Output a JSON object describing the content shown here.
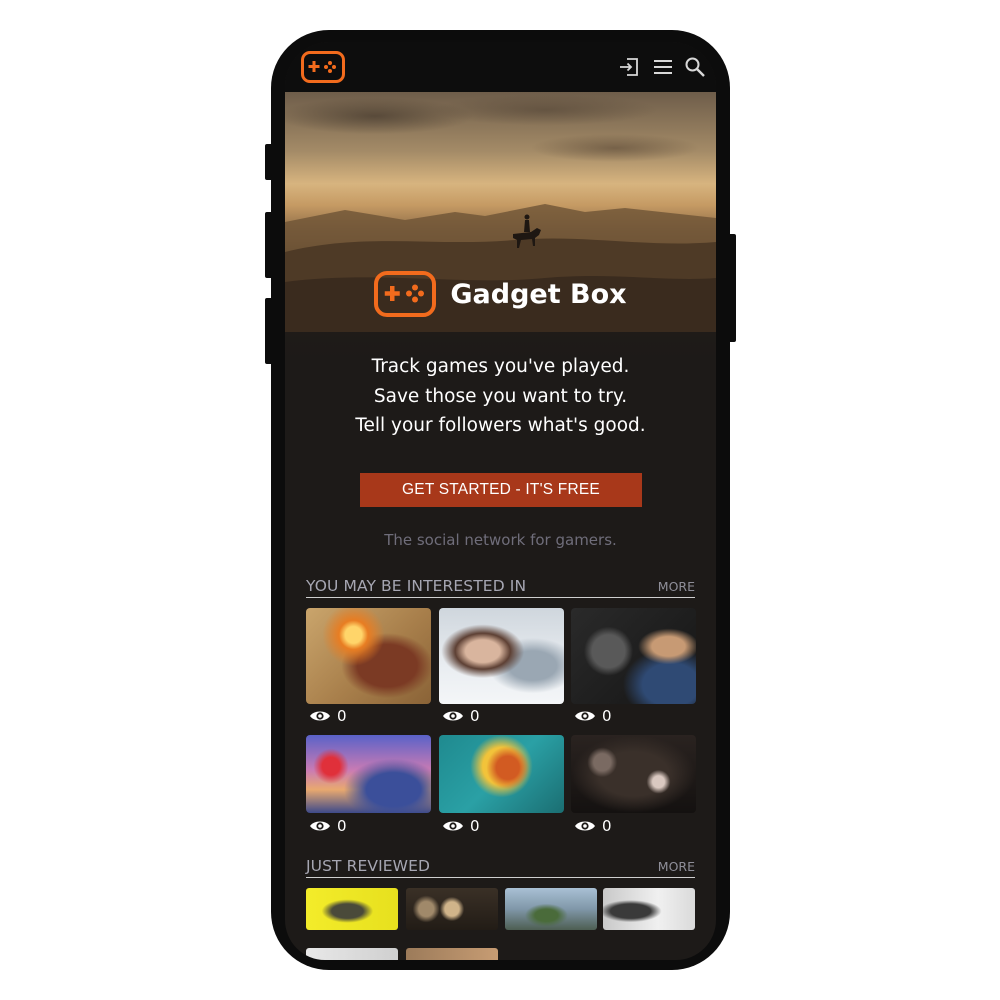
{
  "header": {
    "logo_icon": "gamepad-icon",
    "actions": [
      {
        "icon": "login-icon"
      },
      {
        "icon": "menu-icon"
      },
      {
        "icon": "search-icon"
      }
    ]
  },
  "hero": {
    "brand_name": "Gadget Box",
    "tagline": [
      "Track games you've played.",
      "Save those you want to try.",
      "Tell your followers what's good."
    ],
    "cta_label": "GET STARTED - IT'S FREE",
    "subtagline": "The social network for gamers."
  },
  "sections": {
    "interested": {
      "title": "YOU MAY BE INTERESTED IN",
      "more_label": "MORE",
      "items": [
        {
          "views": "0"
        },
        {
          "views": "0"
        },
        {
          "views": "0"
        },
        {
          "views": "0"
        },
        {
          "views": "0"
        },
        {
          "views": "0"
        }
      ]
    },
    "reviewed": {
      "title": "JUST REVIEWED",
      "more_label": "MORE"
    }
  },
  "colors": {
    "accent": "#f26b1d",
    "cta": "#a8381a",
    "background": "#1d1a18"
  }
}
